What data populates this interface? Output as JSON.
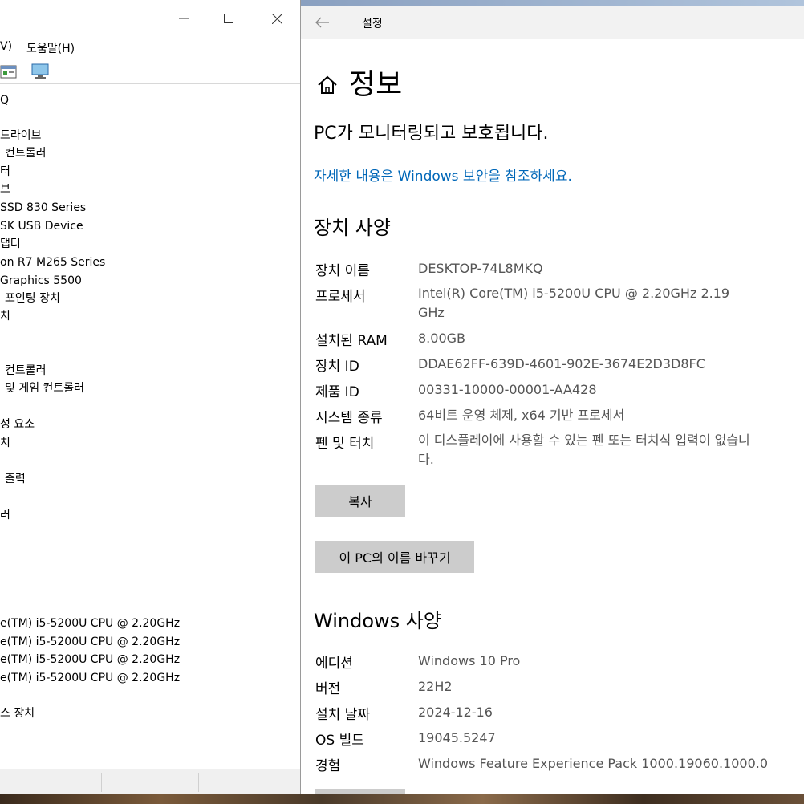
{
  "device_manager": {
    "menu": [
      "V)",
      "도움말(H)"
    ],
    "tree_items": [
      "Q",
      "",
      "드라이브",
      "컨트롤러",
      "터",
      "브",
      "SSD 830 Series",
      "SK USB Device",
      "댑터",
      "on R7 M265 Series",
      "Graphics 5500",
      "포인팅 장치",
      "치",
      "",
      "",
      "컨트롤러",
      "및 게임 컨트롤러",
      "",
      "성 요소",
      "치",
      "",
      "출력",
      "",
      "러",
      "",
      "",
      "",
      "",
      "e(TM) i5-5200U CPU @ 2.20GHz",
      "e(TM) i5-5200U CPU @ 2.20GHz",
      "e(TM) i5-5200U CPU @ 2.20GHz",
      "e(TM) i5-5200U CPU @ 2.20GHz",
      "",
      "스 장치"
    ]
  },
  "settings": {
    "window_title": "설정",
    "page_title": "정보",
    "protection_status": "PC가 모니터링되고 보호됩니다.",
    "security_link": "자세한 내용은 Windows 보안을 참조하세요.",
    "device_specs": {
      "heading": "장치 사양",
      "rows": [
        {
          "label": "장치 이름",
          "value": "DESKTOP-74L8MKQ"
        },
        {
          "label": "프로세서",
          "value": "Intel(R) Core(TM) i5-5200U CPU @ 2.20GHz   2.19 GHz"
        },
        {
          "label": "설치된 RAM",
          "value": "8.00GB"
        },
        {
          "label": "장치 ID",
          "value": "DDAE62FF-639D-4601-902E-3674E2D3D8FC"
        },
        {
          "label": "제품 ID",
          "value": "00331-10000-00001-AA428"
        },
        {
          "label": "시스템 종류",
          "value": "64비트 운영 체제, x64 기반 프로세서"
        },
        {
          "label": "펜 및 터치",
          "value": "이 디스플레이에 사용할 수 있는 펜 또는 터치식 입력이 없습니다."
        }
      ],
      "copy_button": "복사",
      "rename_button": "이 PC의 이름 바꾸기"
    },
    "windows_specs": {
      "heading": "Windows 사양",
      "rows": [
        {
          "label": "에디션",
          "value": "Windows 10 Pro"
        },
        {
          "label": "버전",
          "value": "22H2"
        },
        {
          "label": "설치 날짜",
          "value": "2024-12-16"
        },
        {
          "label": "OS 빌드",
          "value": "19045.5247"
        },
        {
          "label": "경험",
          "value": "Windows Feature Experience Pack 1000.19060.1000.0"
        }
      ]
    }
  },
  "colors": {
    "link": "#0067b8",
    "button_bg": "#cccccc",
    "value_text": "#555555"
  }
}
